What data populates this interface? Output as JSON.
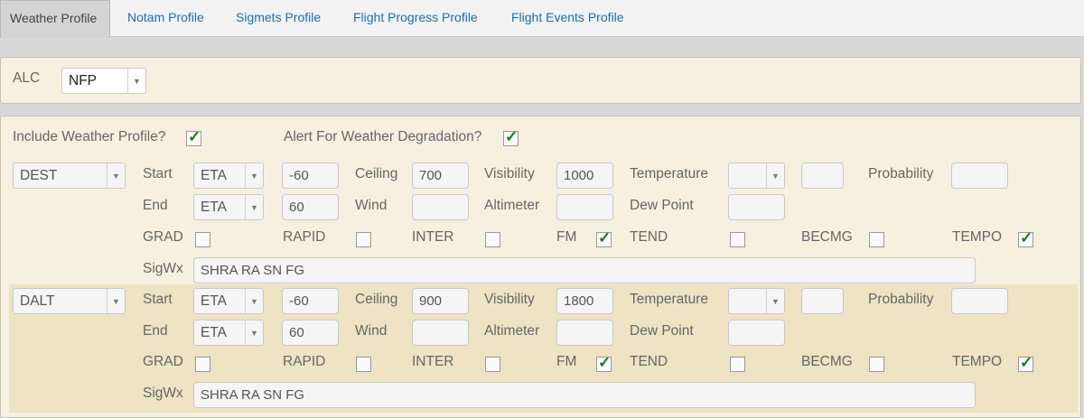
{
  "tabs": [
    {
      "label": "Weather Profile"
    },
    {
      "label": "Notam Profile"
    },
    {
      "label": "Sigmets Profile"
    },
    {
      "label": "Flight Progress Profile"
    },
    {
      "label": "Flight Events Profile"
    }
  ],
  "alc": {
    "label": "ALC",
    "value": "NFP"
  },
  "options": {
    "include_label": "Include Weather Profile?",
    "include_checked": true,
    "alert_label": "Alert For Weather Degradation?",
    "alert_checked": true
  },
  "labels": {
    "start": "Start",
    "end": "End",
    "ceiling": "Ceiling",
    "wind": "Wind",
    "visibility": "Visibility",
    "altimeter": "Altimeter",
    "temperature": "Temperature",
    "dew_point": "Dew Point",
    "probability": "Probability",
    "sigwx": "SigWx",
    "grad": "GRAD",
    "rapid": "RAPID",
    "inter": "INTER",
    "fm": "FM",
    "tend": "TEND",
    "becmg": "BECMG",
    "tempo": "TEMPO"
  },
  "profiles": [
    {
      "airport": "DEST",
      "start_ref": "ETA",
      "start_offset": "-60",
      "end_ref": "ETA",
      "end_offset": "60",
      "ceiling": "700",
      "wind": "",
      "visibility": "1000",
      "altimeter": "",
      "temperature_op": "",
      "temperature": "",
      "dew_point": "",
      "probability": "",
      "sigwx": "SHRA RA SN FG",
      "checks": {
        "grad": false,
        "rapid": false,
        "inter": false,
        "fm": true,
        "tend": false,
        "becmg": false,
        "tempo": true
      }
    },
    {
      "airport": "DALT",
      "start_ref": "ETA",
      "start_offset": "-60",
      "end_ref": "ETA",
      "end_offset": "60",
      "ceiling": "900",
      "wind": "",
      "visibility": "1800",
      "altimeter": "",
      "temperature_op": "",
      "temperature": "",
      "dew_point": "",
      "probability": "",
      "sigwx": "SHRA RA SN FG",
      "checks": {
        "grad": false,
        "rapid": false,
        "inter": false,
        "fm": true,
        "tend": false,
        "becmg": false,
        "tempo": true
      }
    }
  ],
  "icons": {
    "dropdown": "chevron-down-icon",
    "check": "checkmark-icon"
  },
  "colors": {
    "tab_link": "#1a6fb3",
    "panel_bg": "#f5f0e0",
    "alt_row_bg": "#eee3c2",
    "check": "#1d7a1d"
  }
}
